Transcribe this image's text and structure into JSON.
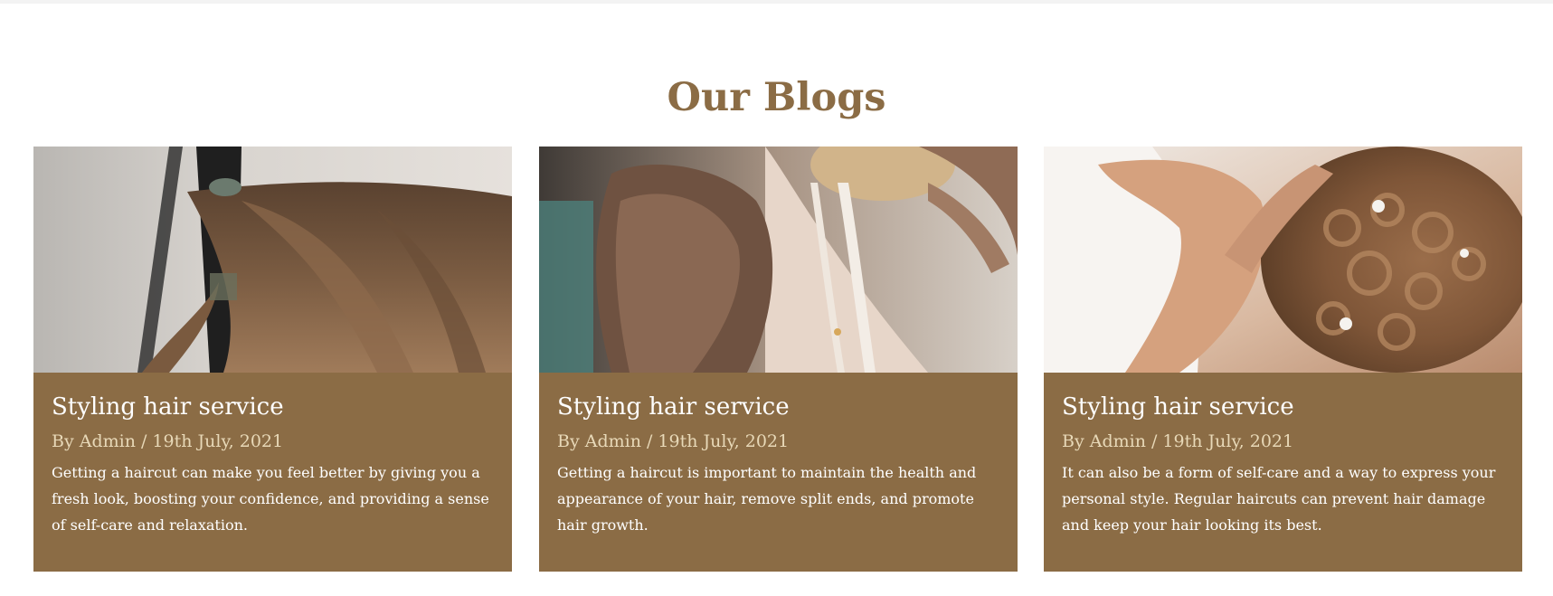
{
  "section": {
    "title": "Our Blogs"
  },
  "posts": [
    {
      "image_subject": "curling-iron-brown-hair-photo",
      "title": "Styling hair service",
      "meta": "By Admin / 19th July, 2021",
      "excerpt": "Getting a haircut can make you feel better by giving you a fresh look, boosting your confidence, and providing a sense of self-care and relaxation."
    },
    {
      "image_subject": "updo-hair-styling-photo",
      "title": "Styling hair service",
      "meta": "By Admin / 19th July, 2021",
      "excerpt": "Getting a haircut is important to maintain the health and appearance of your hair, remove split ends, and promote hair growth."
    },
    {
      "image_subject": "curly-bridal-updo-pearl-pins-photo",
      "title": "Styling hair service",
      "meta": "By Admin / 19th July, 2021",
      "excerpt": "It can also be a form of self-care and a way to express your personal style. Regular haircuts can prevent hair damage and keep your hair looking its best."
    }
  ],
  "colors": {
    "accent": "#8b6c45",
    "meta_text": "#e8d9b8",
    "card_text": "#ffffff"
  }
}
